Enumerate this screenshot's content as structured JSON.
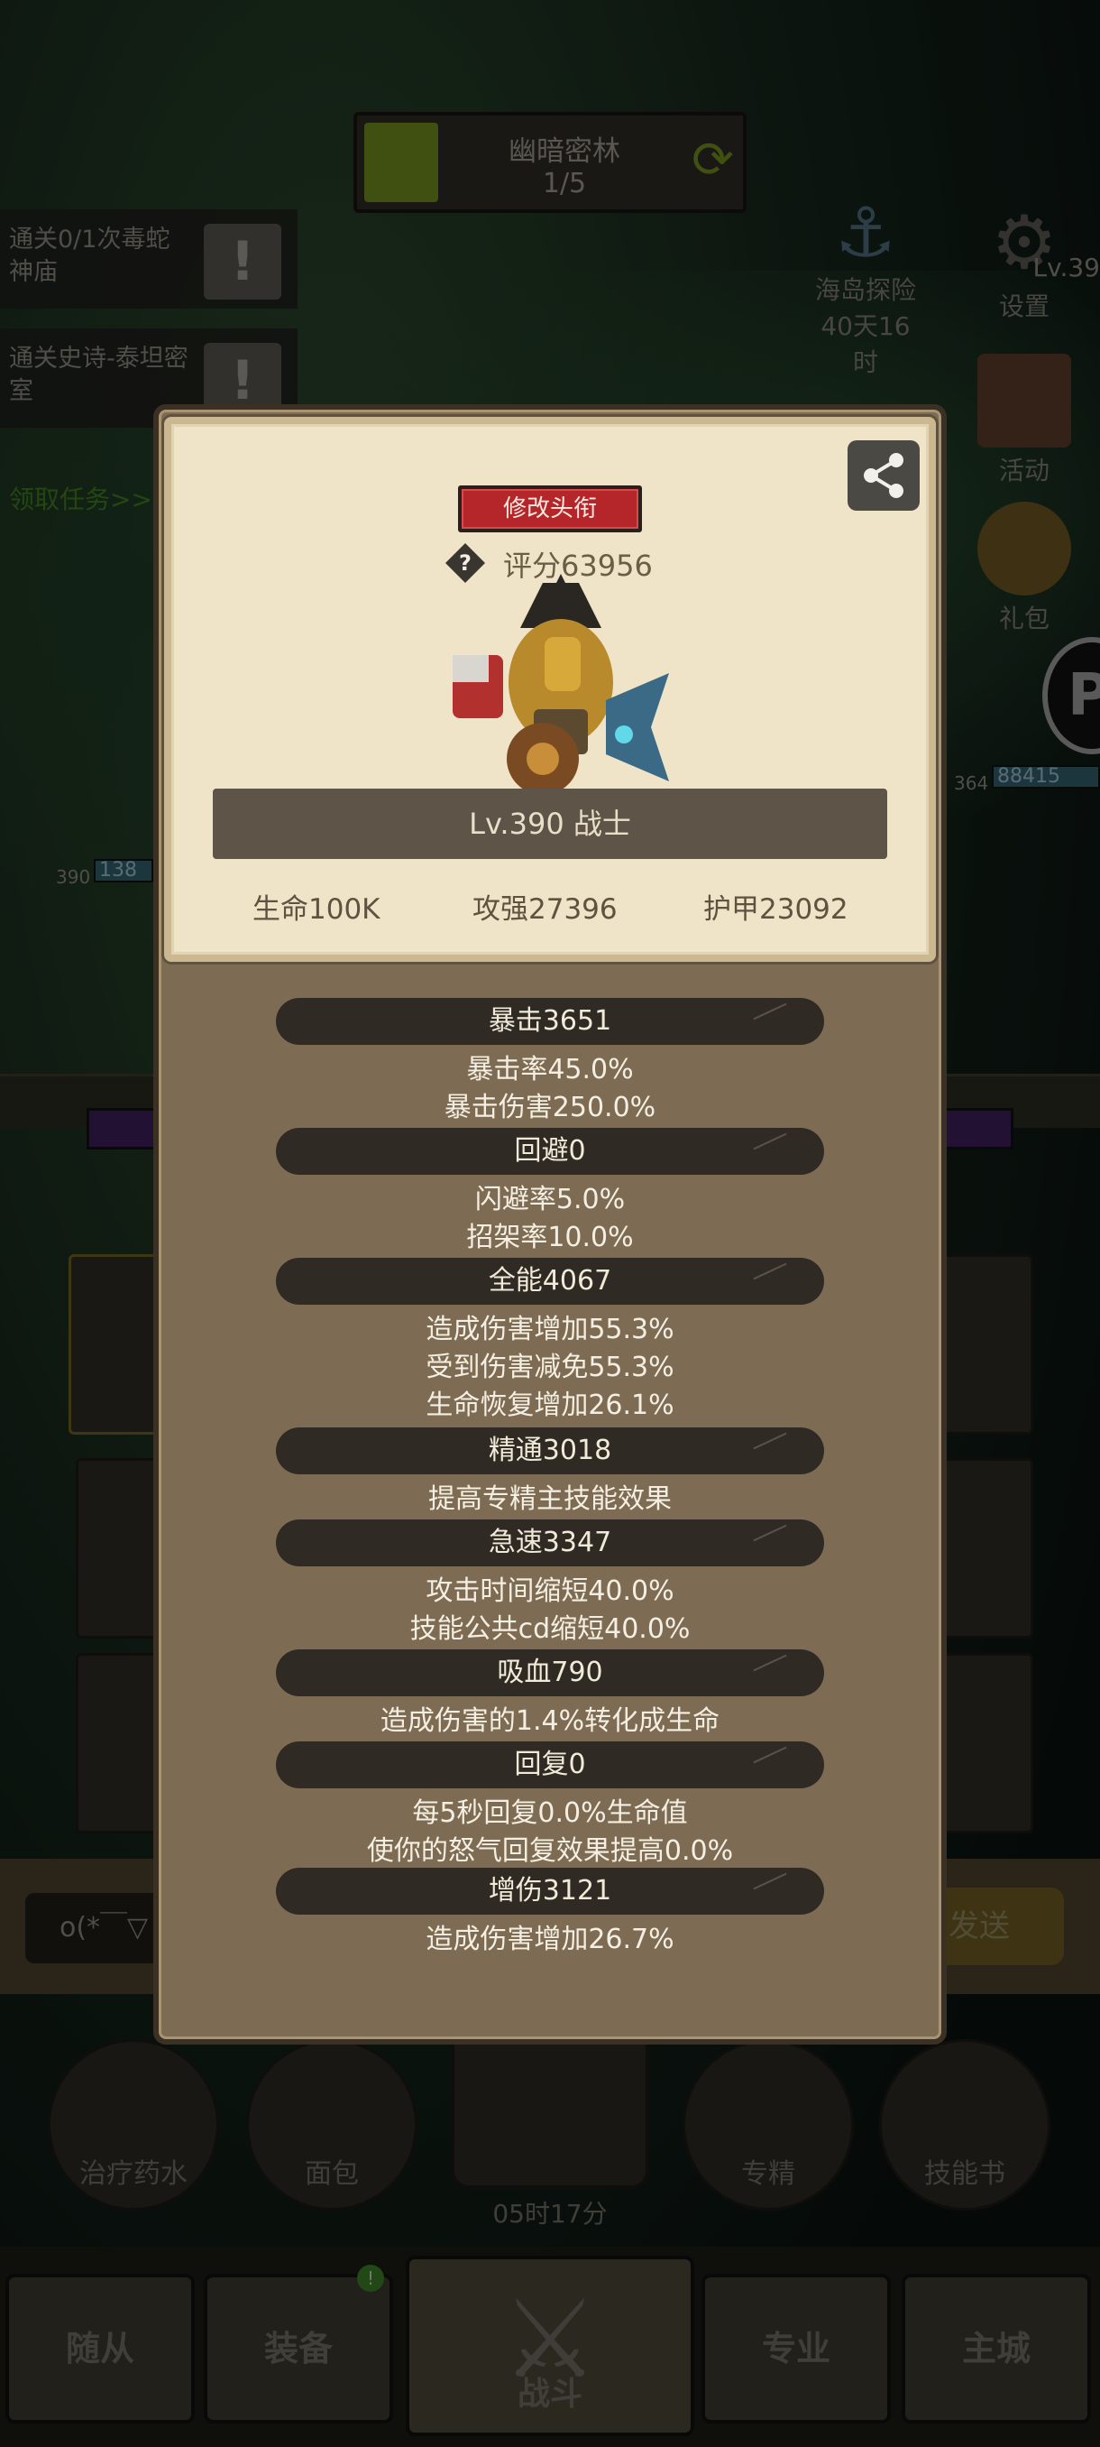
{
  "background": {
    "stage": {
      "name": "幽暗密林",
      "progress": "1/5"
    },
    "quests": [
      {
        "text": "通关0/1次毒蛇神庙"
      },
      {
        "text": "通关史诗-泰坦密室"
      }
    ],
    "get_task": "领取任务>>",
    "side_icons": [
      {
        "label": "海岛探险",
        "sub": "40天16时"
      },
      {
        "label": "设置"
      },
      {
        "label": "活动"
      },
      {
        "label": "礼包"
      }
    ],
    "corner_level": "Lv.39",
    "enemy_hp": {
      "level": "364",
      "value": "88415"
    },
    "ally_hp": {
      "level": "390",
      "value": "138"
    },
    "chat": {
      "input_text": "o(*￣▽",
      "send_label": "发送"
    },
    "items": [
      {
        "label": "治疗药水"
      },
      {
        "label": "面包"
      },
      {
        "label": "专精"
      },
      {
        "label": "技能书"
      }
    ],
    "timer": "05时17分",
    "nav": [
      {
        "label": "随从"
      },
      {
        "label": "装备"
      },
      {
        "label": "战斗"
      },
      {
        "label": "专业"
      },
      {
        "label": "主城"
      }
    ],
    "nav_badge": "!"
  },
  "profile": {
    "edit_title_label": "修改头衔",
    "score": "评分63956",
    "class_banner": "Lv.390 战士",
    "basic": [
      {
        "text": "生命100K"
      },
      {
        "text": "攻强27396"
      },
      {
        "text": "护甲23092"
      }
    ]
  },
  "stats": [
    {
      "header": "暴击3651",
      "lines": [
        "暴击率45.0%",
        "暴击伤害250.0%"
      ]
    },
    {
      "header": "回避0",
      "lines": [
        "闪避率5.0%",
        "招架率10.0%"
      ]
    },
    {
      "header": "全能4067",
      "lines": [
        "造成伤害增加55.3%",
        "受到伤害减免55.3%",
        "生命恢复增加26.1%"
      ]
    },
    {
      "header": "精通3018",
      "lines": [
        "提高专精主技能效果"
      ]
    },
    {
      "header": "急速3347",
      "lines": [
        "攻击时间缩短40.0%",
        "技能公共cd缩短40.0%"
      ]
    },
    {
      "header": "吸血790",
      "lines": [
        "造成伤害的1.4%转化成生命"
      ]
    },
    {
      "header": "回复0",
      "lines": [
        "每5秒回复0.0%生命值",
        "使你的怒气回复效果提高0.0%"
      ]
    },
    {
      "header": "增伤3121",
      "lines": [
        "造成伤害增加26.7%"
      ]
    }
  ]
}
